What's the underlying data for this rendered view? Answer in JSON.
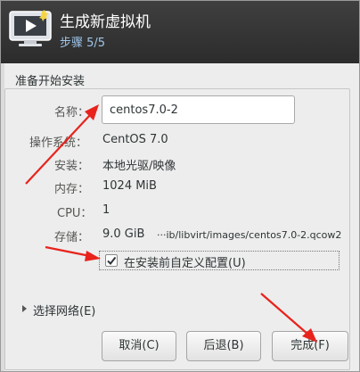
{
  "window": {
    "title": "生成新虚拟机",
    "step": "步骤 5/5"
  },
  "section": {
    "heading": "准备开始安装"
  },
  "form": {
    "name_label": "名称：",
    "name_value": "centos7.0-2",
    "os_label": "操作系统：",
    "os_value": "CentOS 7.0",
    "install_label": "安装：",
    "install_value": "本地光驱/映像",
    "memory_label": "内存：",
    "memory_value": "1024 MiB",
    "cpu_label": "CPU：",
    "cpu_value": "1",
    "storage_label": "存储：",
    "storage_size": "9.0 GiB",
    "storage_path": "···ib/libvirt/images/centos7.0-2.qcow2"
  },
  "customize": {
    "checked": true,
    "label": "在安装前自定义配置(U)"
  },
  "network": {
    "expander_label": "选择网络(E)"
  },
  "buttons": {
    "cancel": "取消(C)",
    "back": "后退(B)",
    "finish": "完成(F)"
  },
  "colors": {
    "titlebar": "#333333",
    "subtitle": "#9fc6ea",
    "annotation_arrow": "#e8231c"
  }
}
